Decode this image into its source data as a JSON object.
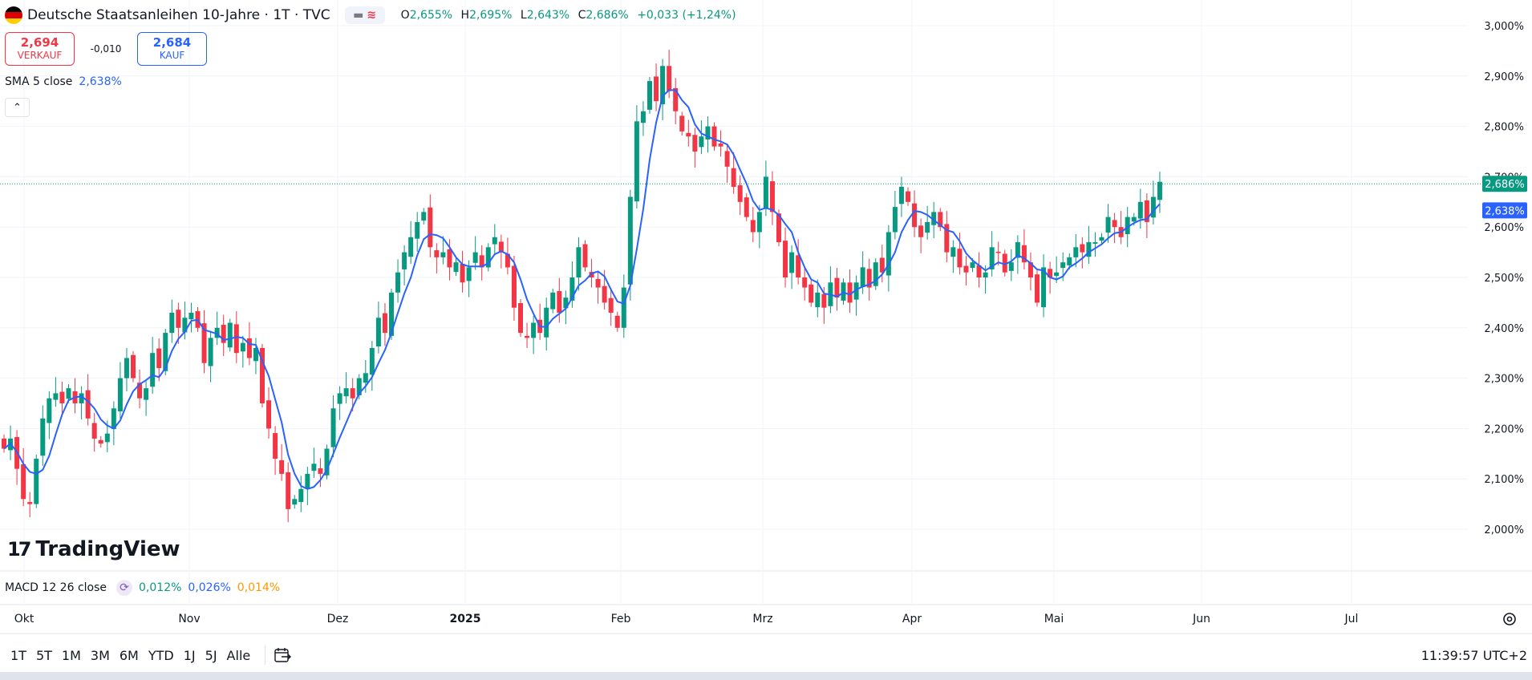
{
  "header": {
    "title": "Deutsche Staatsanleihen 10-Jahre · 1T · TVC",
    "ohlc": [
      {
        "k": "O",
        "v": "2,655%"
      },
      {
        "k": "H",
        "v": "2,695%"
      },
      {
        "k": "L",
        "v": "2,643%"
      },
      {
        "k": "C",
        "v": "2,686%"
      }
    ],
    "change": "+0,033 (+1,24%)",
    "flag_colors": [
      "#000000",
      "#dd0000",
      "#ffce00"
    ]
  },
  "trade": {
    "sell_price": "2,694",
    "sell_label": "VERKAUF",
    "spread": "-0,010",
    "buy_price": "2,684",
    "buy_label": "KAUF"
  },
  "sma": {
    "label": "SMA 5 close",
    "value": "2,638%"
  },
  "logo": {
    "mark": "17",
    "text": "TradingView"
  },
  "macd": {
    "label": "MACD 12 26 close",
    "v1": "0,012%",
    "v2": "0,026%",
    "v3": "0,014%"
  },
  "time_ranges": [
    "1T",
    "5T",
    "1M",
    "3M",
    "6M",
    "YTD",
    "1J",
    "5J",
    "Alle"
  ],
  "clock": "11:39:57 UTC+2",
  "colors": {
    "up": "#089981",
    "down": "#f23645",
    "sma": "#2962ff",
    "grid": "#f0f3fa"
  },
  "chart_data": {
    "type": "candlestick",
    "y_ticks": [
      "3,000%",
      "2,900%",
      "2,800%",
      "2,700%",
      "2,600%",
      "2,500%",
      "2,400%",
      "2,300%",
      "2,200%",
      "2,100%",
      "2,000%"
    ],
    "x_ticks": [
      "Okt",
      "Nov",
      "Dez",
      "2025",
      "Feb",
      "Mrz",
      "Apr",
      "Mai",
      "Jun",
      "Jul"
    ],
    "ylim": [
      1.92,
      3.03
    ],
    "last_price_label": "2,686%",
    "sma_label": "2,638%",
    "last_price": 2.686,
    "sma_last": 2.638,
    "closes": [
      2.16,
      2.18,
      2.12,
      2.06,
      2.05,
      2.14,
      2.22,
      2.26,
      2.27,
      2.25,
      2.28,
      2.25,
      2.27,
      2.22,
      2.18,
      2.17,
      2.19,
      2.24,
      2.3,
      2.34,
      2.3,
      2.26,
      2.28,
      2.35,
      2.32,
      2.39,
      2.43,
      2.4,
      2.42,
      2.43,
      2.4,
      2.33,
      2.38,
      2.4,
      2.37,
      2.41,
      2.35,
      2.37,
      2.34,
      2.36,
      2.25,
      2.2,
      2.14,
      2.11,
      2.04,
      2.06,
      2.08,
      2.11,
      2.13,
      2.11,
      2.16,
      2.24,
      2.27,
      2.28,
      2.26,
      2.3,
      2.31,
      2.36,
      2.42,
      2.39,
      2.47,
      2.51,
      2.55,
      2.58,
      2.61,
      2.63,
      2.56,
      2.54,
      2.55,
      2.52,
      2.53,
      2.49,
      2.52,
      2.55,
      2.52,
      2.56,
      2.58,
      2.55,
      2.52,
      2.44,
      2.39,
      2.38,
      2.41,
      2.39,
      2.44,
      2.47,
      2.43,
      2.46,
      2.5,
      2.56,
      2.52,
      2.5,
      2.48,
      2.45,
      2.43,
      2.4,
      2.48,
      2.66,
      2.81,
      2.83,
      2.89,
      2.85,
      2.92,
      2.87,
      2.83,
      2.79,
      2.78,
      2.75,
      2.78,
      2.8,
      2.76,
      2.76,
      2.72,
      2.68,
      2.65,
      2.62,
      2.59,
      2.63,
      2.7,
      2.63,
      2.57,
      2.5,
      2.55,
      2.5,
      2.48,
      2.45,
      2.47,
      2.44,
      2.49,
      2.46,
      2.49,
      2.45,
      2.49,
      2.52,
      2.48,
      2.53,
      2.51,
      2.59,
      2.64,
      2.68,
      2.65,
      2.6,
      2.58,
      2.61,
      2.63,
      2.6,
      2.55,
      2.56,
      2.52,
      2.51,
      2.53,
      2.5,
      2.51,
      2.56,
      2.55,
      2.51,
      2.53,
      2.57,
      2.53,
      2.5,
      2.45,
      2.52,
      2.5,
      2.51,
      2.53,
      2.54,
      2.56,
      2.55,
      2.57,
      2.57,
      2.58,
      2.62,
      2.6,
      2.58,
      2.62,
      2.62,
      2.65,
      2.61,
      2.66,
      2.69
    ]
  }
}
